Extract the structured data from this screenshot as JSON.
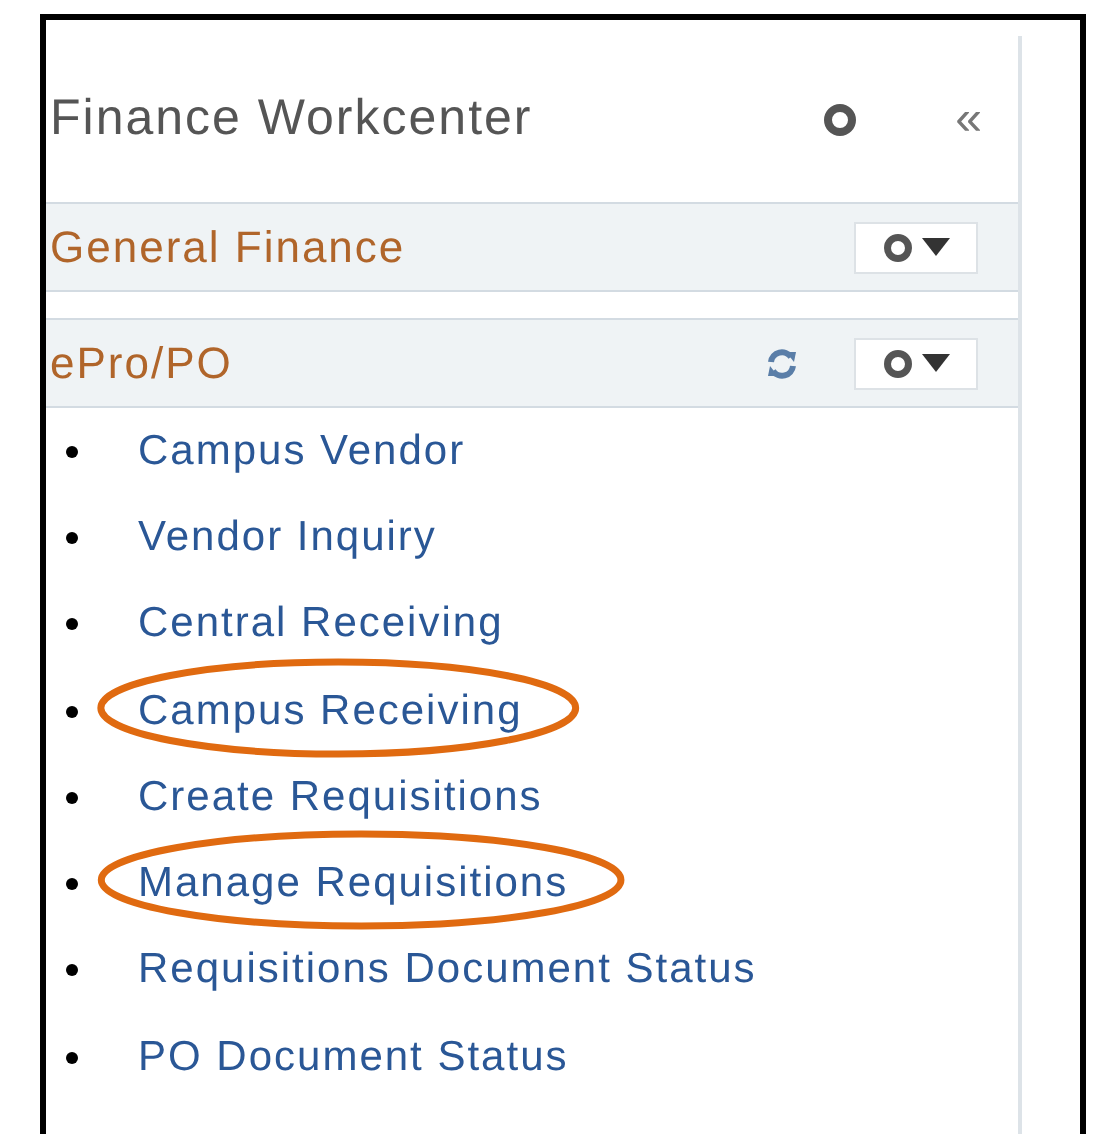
{
  "header": {
    "title": "Finance Workcenter",
    "collapse": "«"
  },
  "sections": [
    {
      "title": "General Finance",
      "refresh": false
    },
    {
      "title": "ePro/PO",
      "refresh": true
    }
  ],
  "links": [
    {
      "label": "Campus Vendor",
      "circled": false
    },
    {
      "label": "Vendor Inquiry",
      "circled": false
    },
    {
      "label": "Central Receiving",
      "circled": false
    },
    {
      "label": "Campus Receiving",
      "circled": true
    },
    {
      "label": "Create Requisitions",
      "circled": false
    },
    {
      "label": "Manage Requisitions",
      "circled": true
    },
    {
      "label": "Requisitions Document Status",
      "circled": false
    },
    {
      "label": "PO Document Status",
      "circled": false
    }
  ]
}
